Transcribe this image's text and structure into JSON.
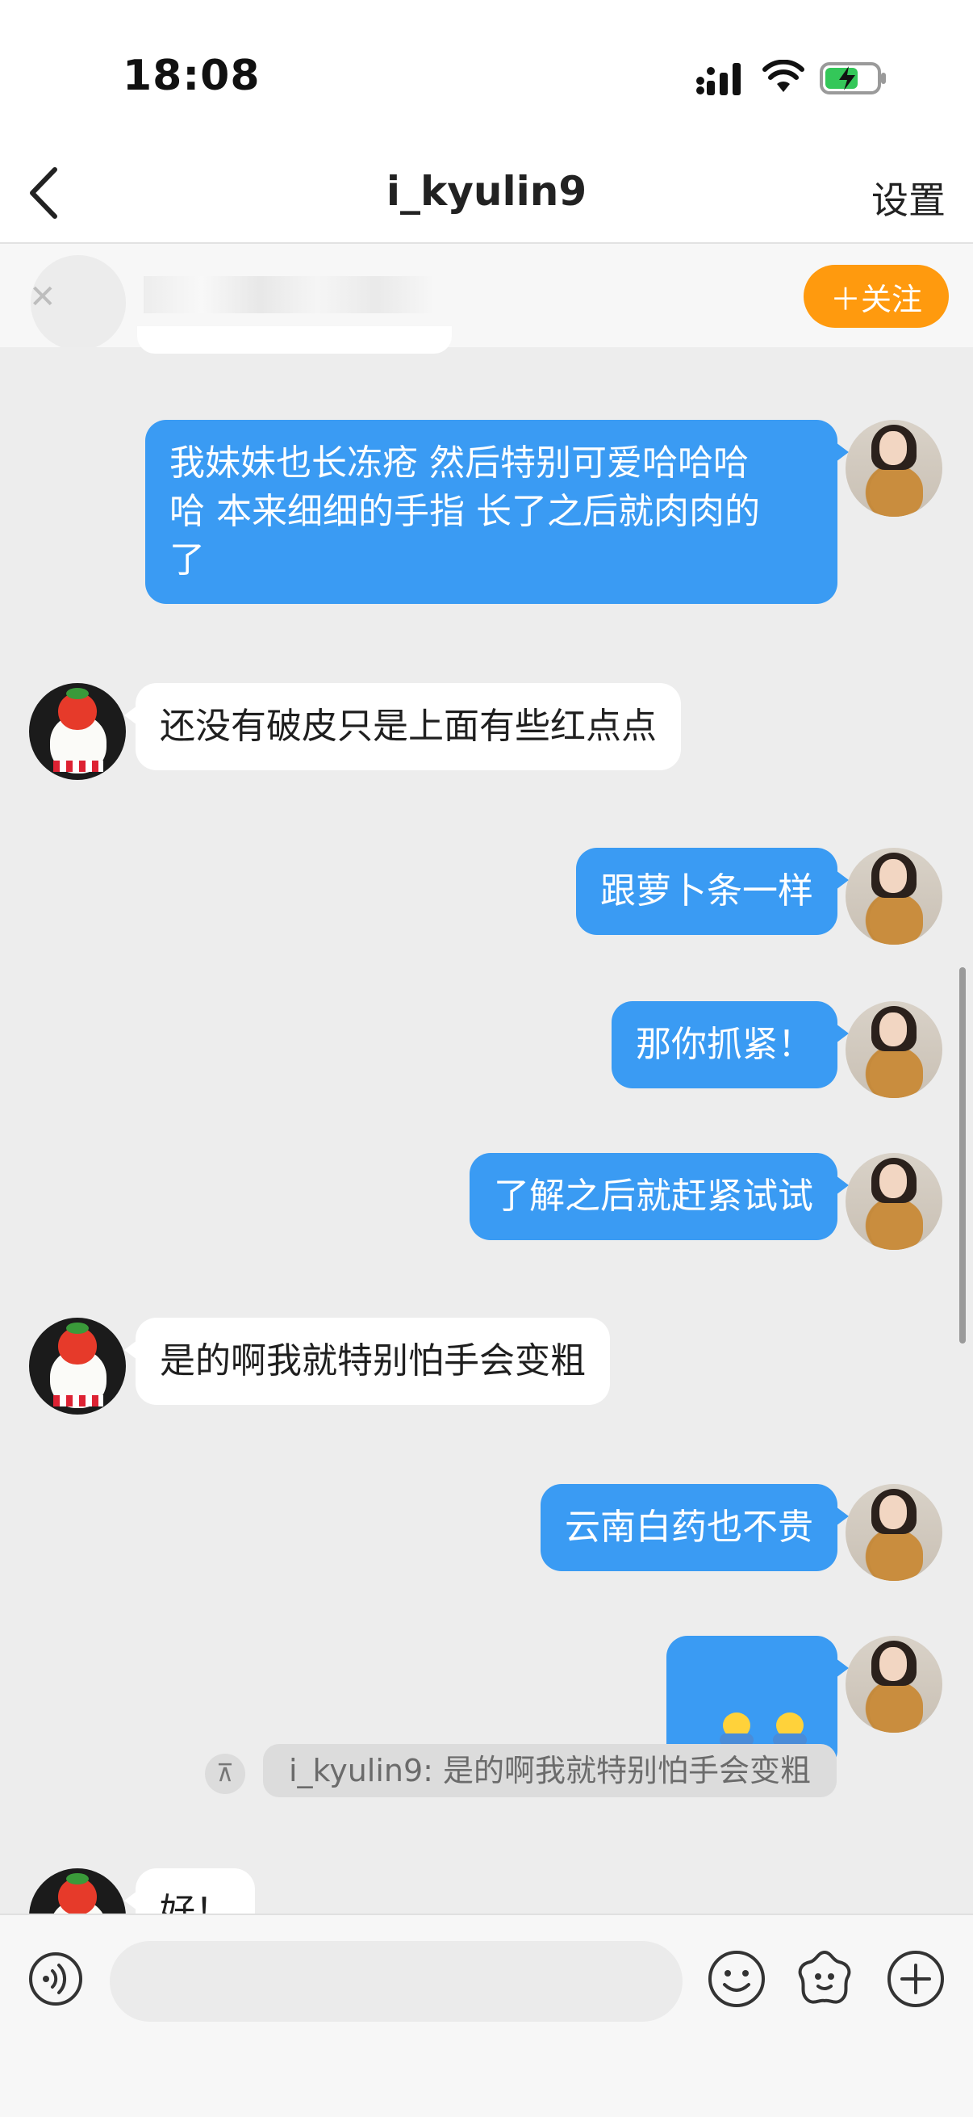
{
  "status_bar": {
    "time": "18:08",
    "icons": [
      "signal-icon",
      "wifi-icon",
      "battery-charging-icon"
    ]
  },
  "header": {
    "title": "i_kyulin9",
    "settings_label": "设置"
  },
  "follow_bar": {
    "button_label": "＋关注"
  },
  "messages": [
    {
      "from": "me",
      "text": "我妹妹也长冻疮 然后特别可爱哈哈哈\n哈 本来细细的手指 长了之后就肉肉的\n了"
    },
    {
      "from": "them",
      "text": "还没有破皮只是上面有些红点点"
    },
    {
      "from": "me",
      "text": "跟萝卜条一样"
    },
    {
      "from": "me",
      "text": "那你抓紧！"
    },
    {
      "from": "me",
      "text": "了解之后就赶紧试试"
    },
    {
      "from": "them",
      "text": "是的啊我就特别怕手会变粗"
    },
    {
      "from": "me",
      "text": "云南白药也不贵"
    },
    {
      "from": "me",
      "text": "",
      "emojis": [
        "person-emoji",
        "person-emoji"
      ]
    },
    {
      "from": "them",
      "text": "好！"
    }
  ],
  "quote": {
    "text": "i_kyulin9: 是的啊我就特别怕手会变粗"
  },
  "input_bar": {
    "value": "",
    "placeholder": ""
  },
  "colors": {
    "my_bubble": "#3a9bf3",
    "their_bubble": "#ffffff",
    "follow_button": "#ff9a0e",
    "background": "#ededed"
  }
}
